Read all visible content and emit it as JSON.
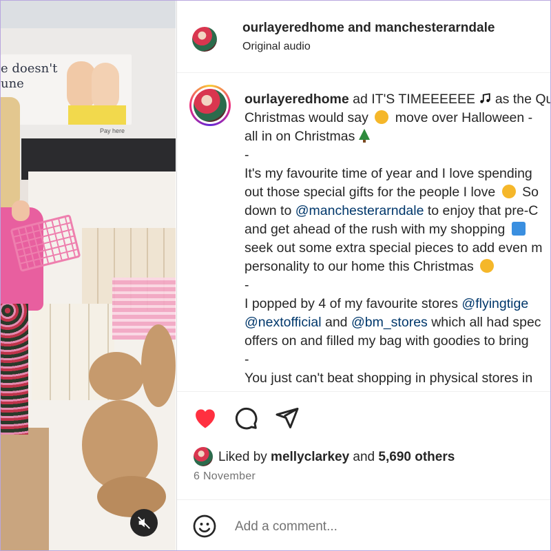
{
  "media": {
    "billboard_text": "e doesn't\nune",
    "pay_here": "Pay here"
  },
  "header": {
    "users": "ourlayeredhome and manchesterarndale",
    "audio": "Original audio"
  },
  "caption": {
    "username": "ourlayeredhome",
    "line1_text": " ad IT'S TIMEEEEEE ",
    "line1_after": " as the Qu",
    "line2_a": "Christmas would say ",
    "line2_b": " move over Halloween - ",
    "line3": "all in on Christmas ",
    "dash": "-",
    "line4": "It's my favourite time of year and I love spending",
    "line5": "out those special gifts for the people I love ",
    "line5_after": " So",
    "line6_a": "down to ",
    "mention_arndale": "@manchesterarndale",
    "line6_b": " to enjoy that pre-C",
    "line7": "and get ahead of the rush with my shopping ",
    "line8": "seek out some extra special pieces to add even m",
    "line9": "personality to our home this Christmas ",
    "line10_a": "I popped by 4 of my favourite stores ",
    "mention_flyingtiger": "@flyingtige",
    "mention_next": "@nextofficial",
    "line11_mid": " and ",
    "mention_bm": "@bm_stores",
    "line11_b": " which all had spec",
    "line12": "offers on and filled my bag with goodies to bring",
    "line13": "You just can't beat shopping in physical stores in"
  },
  "engagement": {
    "liked_prefix": "Liked by ",
    "liked_user": "mellyclarkey",
    "liked_mid": " and ",
    "liked_count": "5,690 others",
    "date": "6 November"
  },
  "comment": {
    "placeholder": "Add a comment..."
  },
  "colors": {
    "like_red": "#ff3040",
    "mention_blue": "#00376b",
    "muted_gray": "#737373"
  }
}
